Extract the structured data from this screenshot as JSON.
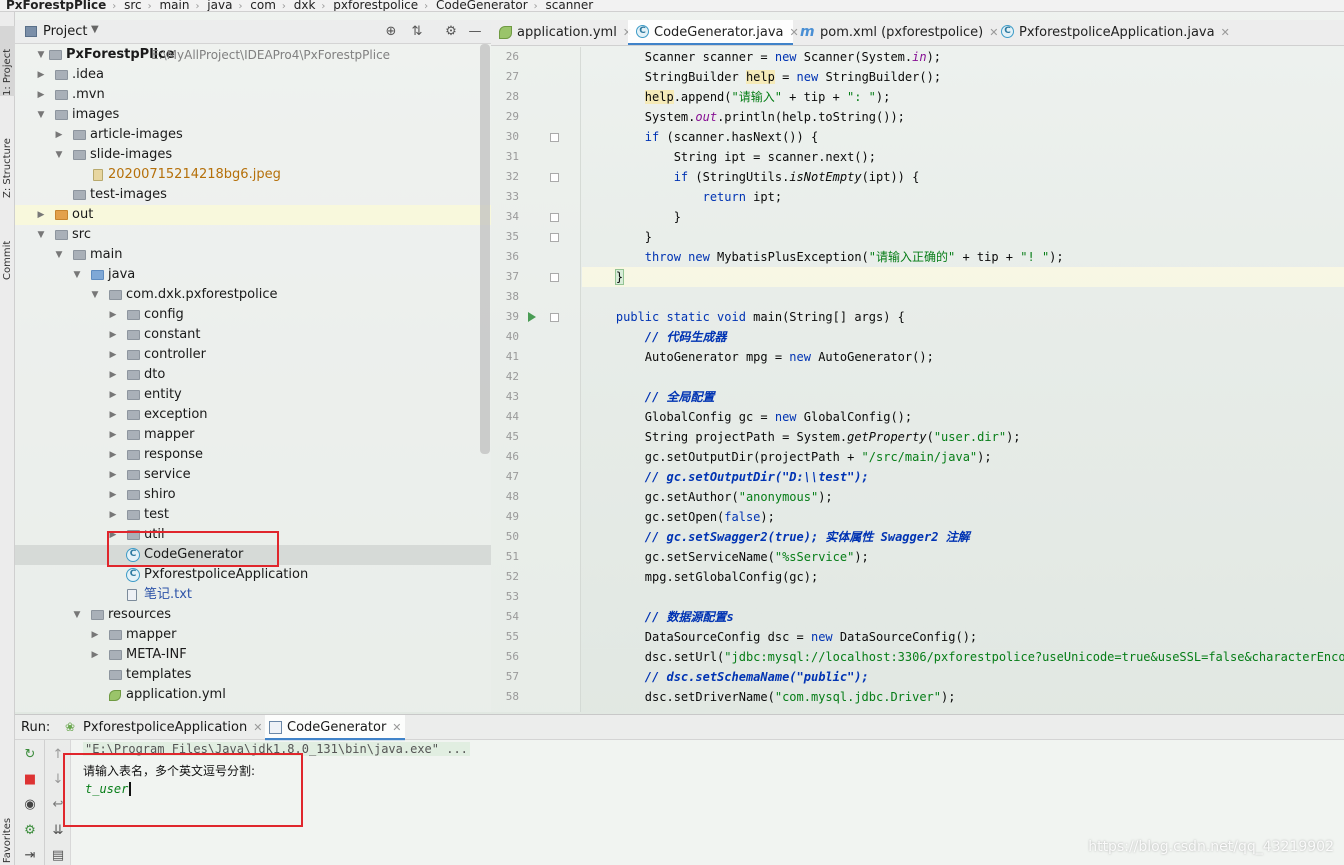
{
  "breadcrumb": [
    "PxForestpPlice",
    "src",
    "main",
    "java",
    "com",
    "dxk",
    "pxforestpolice",
    "CodeGenerator",
    "scanner"
  ],
  "side_tabs": {
    "project": "1: Project",
    "structure": "Z: Structure",
    "commit": "Commit",
    "favorites": "2: Favorites"
  },
  "project_panel": {
    "title": "Project",
    "root": {
      "name": "PxForestpPlice",
      "path": "E:\\MyAllProject\\IDEAPro4\\PxForestpPlice"
    },
    "items": [
      ".idea",
      ".mvn",
      "images",
      "article-images",
      "slide-images",
      "20200715214218bg6.jpeg",
      "test-images",
      "out",
      "src",
      "main",
      "java",
      "com.dxk.pxforestpolice",
      "config",
      "constant",
      "controller",
      "dto",
      "entity",
      "exception",
      "mapper",
      "response",
      "service",
      "shiro",
      "test",
      "util",
      "CodeGenerator",
      "PxforestpoliceApplication",
      "笔记.txt",
      "resources",
      "mapper",
      "META-INF",
      "templates",
      "application.yml"
    ]
  },
  "editor": {
    "tabs": [
      {
        "label": "application.yml",
        "icon": "yaml-icon"
      },
      {
        "label": "CodeGenerator.java",
        "icon": "class-icon",
        "active": true
      },
      {
        "label": "pom.xml (pxforestpolice)",
        "icon": "maven-icon"
      },
      {
        "label": "PxforestpoliceApplication.java",
        "icon": "class-icon"
      }
    ],
    "line_numbers": [
      "26",
      "27",
      "28",
      "29",
      "30",
      "31",
      "32",
      "33",
      "34",
      "35",
      "36",
      "37",
      "38",
      "39",
      "40",
      "41",
      "42",
      "43",
      "44",
      "45",
      "46",
      "47",
      "48",
      "49",
      "50",
      "51",
      "52",
      "53",
      "54",
      "55",
      "56",
      "57",
      "58"
    ]
  },
  "run_panel": {
    "label": "Run:",
    "tabs": [
      "PxforestpoliceApplication",
      "CodeGenerator"
    ],
    "command": "\"E:\\Program Files\\Java\\jdk1.8.0_131\\bin\\java.exe\" ...",
    "prompt": "请输入表名，多个英文逗号分割:",
    "user_input": "t_user"
  },
  "watermark": "https://blog.csdn.net/qq_43219902",
  "colors": {
    "accent": "#4083c9",
    "highlight_box": "#e0262c",
    "keyword": "#0033b3",
    "string": "#067d17"
  }
}
